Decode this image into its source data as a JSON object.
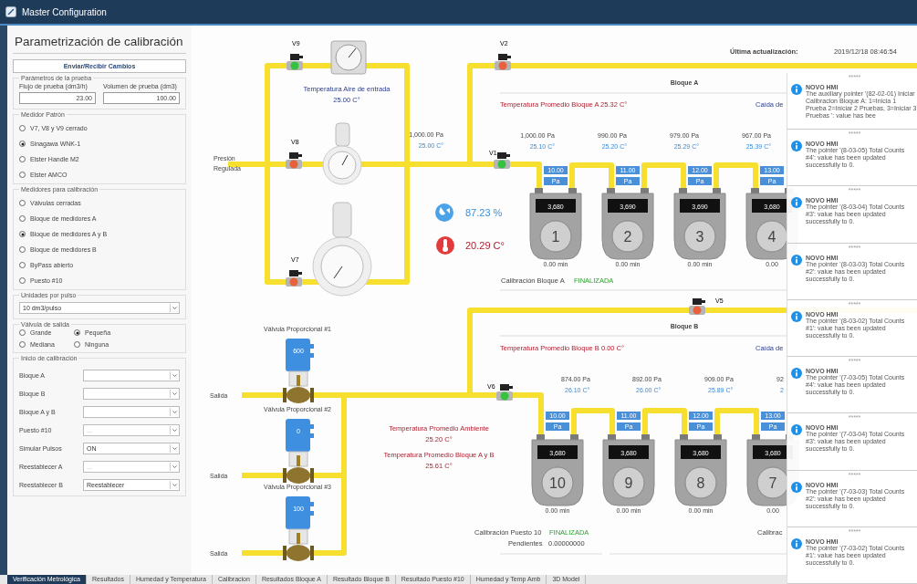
{
  "window": {
    "title": "Master Configuration"
  },
  "panel": {
    "title": "Parametrización de calibración",
    "send_button": "Enviar/Recibir Cambios",
    "test_params": {
      "legend": "Parámetros de la prueba",
      "fields": [
        {
          "label": "Flujo de prueba (dm3/h)",
          "value": "23.00"
        },
        {
          "label": "Volumen de prueba (dm3)",
          "value": "100.00"
        }
      ]
    },
    "radio_groups": [
      {
        "legend": "Medidor Patrón",
        "options": [
          {
            "label": "V7, V8 y V9 cerrado",
            "selected": false
          },
          {
            "label": "Sinagawa WNK-1",
            "selected": true
          },
          {
            "label": "Elster Handle M2",
            "selected": false
          },
          {
            "label": "Elster AMCO",
            "selected": false
          }
        ]
      },
      {
        "legend": "Medidores para calibración",
        "options": [
          {
            "label": "Válvulas cerradas",
            "selected": false
          },
          {
            "label": "Bloque de medidores A",
            "selected": false
          },
          {
            "label": "Bloque de medidores A y B",
            "selected": true
          },
          {
            "label": "Bloque de medidores B",
            "selected": false
          },
          {
            "label": "ByPass abierto",
            "selected": false
          },
          {
            "label": "Puesto #10",
            "selected": false
          }
        ]
      }
    ],
    "pulse_units": {
      "legend": "Unidades por pulso",
      "value": "10 dm3/pulso"
    },
    "outlet_valve": {
      "legend": "Válvula de salida",
      "options": [
        {
          "label": "Grande",
          "selected": false
        },
        {
          "label": "Pequeña",
          "selected": true
        },
        {
          "label": "Mediana",
          "selected": false
        },
        {
          "label": "Ninguna",
          "selected": false
        }
      ]
    },
    "start": {
      "legend": "Inicio de calibración",
      "rows": [
        {
          "label": "Bloque A"
        },
        {
          "label": "Bloque B"
        },
        {
          "label": "Bloque A y B"
        },
        {
          "label": "Puesto #10",
          "placeholder": "..."
        },
        {
          "label": "Simular Pulsos",
          "value": "ON"
        },
        {
          "label": "Reestablecer A",
          "placeholder": "..."
        },
        {
          "label": "Reestablecer B",
          "value": "Reestablecer"
        }
      ]
    }
  },
  "diagram": {
    "last_update_label": "Última actualización:",
    "last_update": "2019/12/18 08:46:54",
    "inlet_label": "Presión\nRegulada",
    "air_temp_label": "Temperatura Aire de entrada",
    "air_temp": "25.00 C°",
    "inlet_pressure": "1,000.00  Pa",
    "inlet_temp": "25.00  C°",
    "humidity": "87.23 %",
    "temperature": "20.29 C°",
    "valves": [
      {
        "label": "V9",
        "open": true
      },
      {
        "label": "V8",
        "open": false
      },
      {
        "label": "V7",
        "open": false
      },
      {
        "label": "V2",
        "open": false
      },
      {
        "label": "V1",
        "open": true
      },
      {
        "label": "V5",
        "open": false
      },
      {
        "label": "V6",
        "open": true
      }
    ],
    "block_a": {
      "title": "Bloque A",
      "avg_temp": "Temperatura Promedio Bloque A  25.32 C°",
      "drop_label": "Caída de",
      "status_label": "Calibración Bloque A",
      "status": "FINALIZADA",
      "meters": [
        {
          "number": "1",
          "pressure": "1,000.00  Pa",
          "temp": "25.10  C°",
          "flow": "10.00",
          "unit": "Pa",
          "count": "3,680",
          "time": "0.00  min"
        },
        {
          "number": "2",
          "pressure": "990.00  Pa",
          "temp": "25.20  C°",
          "flow": "11.00",
          "unit": "Pa",
          "count": "3,690",
          "time": "0.00  min"
        },
        {
          "number": "3",
          "pressure": "979.00  Pa",
          "temp": "25.29  C°",
          "flow": "12.00",
          "unit": "Pa",
          "count": "3,690",
          "time": "0.00  min"
        },
        {
          "number": "4",
          "pressure": "967.00  Pa",
          "temp": "25.39  C°",
          "flow": "13.00",
          "unit": "Pa",
          "count": "3,680",
          "time": "0.00"
        }
      ]
    },
    "block_b": {
      "title": "Bloque B",
      "avg_temp": "Temperatura Promedio Bloque B 0.00  C°",
      "drop_label": "Caída de",
      "status_label": "Calibración Puesto 10",
      "status": "FINALIZADA",
      "pending_label": "Pendientes",
      "pending": "0.00000000",
      "status_label_2": "Calibrac",
      "meters": [
        {
          "number": "10",
          "pressure": "874.00  Pa",
          "temp": "26.10  C°",
          "flow": "10.00",
          "unit": "Pa",
          "count": "3,680",
          "time": "0.00  min"
        },
        {
          "number": "9",
          "pressure": "892.00 Pa",
          "temp": "26.00 C°",
          "flow": "11.00",
          "unit": "Pa",
          "count": "3,680",
          "time": "0.00  min"
        },
        {
          "number": "8",
          "pressure": "909.00 Pa",
          "temp": "25.89 C°",
          "flow": "12.00",
          "unit": "Pa",
          "count": "3,680",
          "time": "0.00  min"
        },
        {
          "number": "7",
          "pressure": "92",
          "temp": "2",
          "flow": "13.00",
          "unit": "Pa",
          "count": "3,680",
          "time": "0.00"
        }
      ]
    },
    "prop_valves": [
      {
        "label": "Válvula Proporcional #1",
        "value": "600",
        "outlet": "Salida"
      },
      {
        "label": "Válvula Proporcional #2",
        "value": "0",
        "outlet": "Salida"
      },
      {
        "label": "Válvula Proporcional #3",
        "value": "100",
        "outlet": "Salida"
      }
    ],
    "ambient": [
      {
        "label": "Temperatura Promedio Ambiente",
        "value": "25.20 C°"
      },
      {
        "label": "Temperatura Promedio Bloque A y B",
        "value": "25.61 C°"
      }
    ]
  },
  "notifications": [
    {
      "stars": "*****",
      "title": "NOVO HMI",
      "lines": [
        "The auxiliary pointer '(82-02-01) Iniciar Calibracion Bloque A: 1=Inicia 1 Prueba 2=Iniciar 2 Pruebas, 3=Iniciar 3 Pruebas ': value has bee"
      ]
    },
    {
      "stars": "*****",
      "title": "NOVO HMI",
      "lines": [
        "The pointer '(8-03-05) Total Counts",
        "#4': value has been updated",
        "successfully to 0."
      ]
    },
    {
      "stars": "*****",
      "title": "NOVO HMI",
      "lines": [
        "The pointer '(8-03-04) Total Counts",
        "#3': value has been updated",
        "successfully to 0."
      ]
    },
    {
      "stars": "*****",
      "title": "NOVO HMI",
      "lines": [
        "The pointer '(8-03-03) Total Counts",
        "#2': value has been updated",
        "successfully to 0."
      ]
    },
    {
      "stars": "*****",
      "title": "NOVO HMI",
      "lines": [
        "The pointer '(8-03-02) Total Counts",
        "#1': value has been updated",
        "successfully to 0."
      ]
    },
    {
      "stars": "*****",
      "title": "NOVO HMI",
      "lines": [
        "The pointer '(7-03-05) Total Counts",
        "#4': value has been updated",
        "successfully to 0."
      ]
    },
    {
      "stars": "*****",
      "title": "NOVO HMI",
      "lines": [
        "The pointer '(7-03-04) Total Counts",
        "#3': value has been updated",
        "successfully to 0."
      ]
    },
    {
      "stars": "*****",
      "title": "NOVO HMI",
      "lines": [
        "The pointer '(7-03-03) Total Counts",
        "#2': value has been updated",
        "successfully to 0."
      ]
    },
    {
      "stars": "*****",
      "title": "NOVO HMI",
      "lines": [
        "The pointer '(7-03-02) Total Counts",
        "#1': value has been updated",
        "successfully to 0."
      ]
    }
  ],
  "tabs": [
    {
      "label": "Verificación Metrológica",
      "selected": true
    },
    {
      "label": "Resultados",
      "selected": false
    },
    {
      "label": "Humedad y Temperatura",
      "selected": false
    },
    {
      "label": "Calibracion",
      "selected": false
    },
    {
      "label": "Resultados Bloque A",
      "selected": false
    },
    {
      "label": "Resultado Bloque B",
      "selected": false
    },
    {
      "label": "Resultado Puesto #10",
      "selected": false
    },
    {
      "label": "Humedad y Temp Amb",
      "selected": false
    },
    {
      "label": "3D Model",
      "selected": false
    }
  ]
}
